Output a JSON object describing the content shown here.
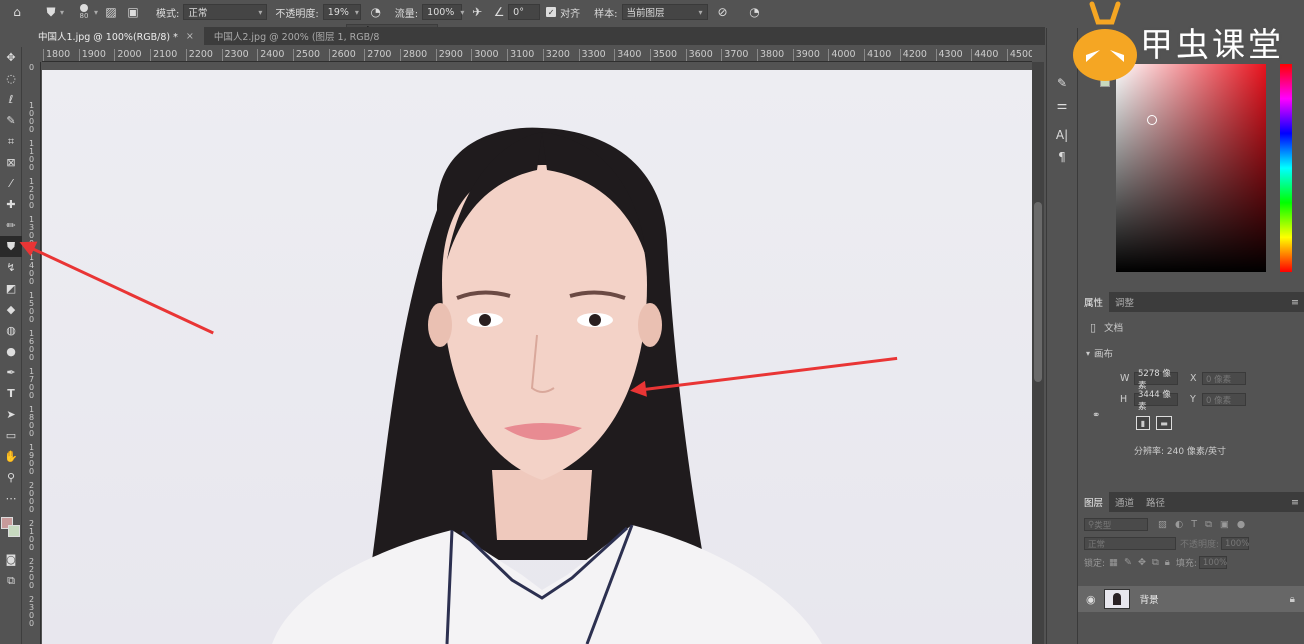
{
  "options_bar": {
    "brush_size": "80",
    "mode_label": "模式:",
    "mode_value": "正常",
    "opacity_label": "不透明度:",
    "opacity_value": "19%",
    "flow_label": "流量:",
    "flow_value": "100%",
    "angle_value": "0°",
    "align_label": "对齐",
    "sample_label": "样本:",
    "sample_value": "当前图层"
  },
  "tabs": [
    {
      "label": "中国人1.jpg @ 100%(RGB/8) *",
      "close": "×"
    },
    {
      "label": "中国人2.jpg @ 200% (图层 1, RGB/8"
    }
  ],
  "ruler_top": [
    "1800",
    "1900",
    "2000",
    "2100",
    "2200",
    "2300",
    "2400",
    "2500",
    "2600",
    "2700",
    "2800",
    "2900",
    "3000",
    "3100",
    "3200",
    "3300",
    "3400",
    "3500",
    "3600",
    "3700",
    "3800",
    "3900",
    "4000",
    "4100",
    "4200",
    "4300",
    "4400",
    "4500"
  ],
  "ruler_left": [
    "0",
    "1000",
    "1100",
    "1200",
    "1300",
    "1400",
    "1500",
    "1600",
    "1700",
    "1800",
    "1900",
    "2000",
    "2100",
    "2200",
    "2300"
  ],
  "watermark": {
    "text": "甲虫课堂"
  },
  "properties_panel": {
    "tab_properties": "属性",
    "tab_adjust": "调整",
    "document_label": "文档",
    "canvas_section": "画布",
    "w_label": "W",
    "w_value": "5278 像素",
    "h_label": "H",
    "h_value": "3444 像素",
    "x_label": "X",
    "x_placeholder": "0 像素",
    "y_label": "Y",
    "y_placeholder": "0 像素",
    "resolution": "分辨率: 240 像素/英寸"
  },
  "layers_panel": {
    "tab_layers": "图层",
    "tab_channels": "通道",
    "tab_paths": "路径",
    "kind_placeholder": "类型",
    "blend_mode": "正常",
    "opacity_label": "不透明度:",
    "opacity_value": "100%",
    "lock_label": "锁定:",
    "fill_label": "填充:",
    "fill_value": "100%",
    "layer_name": "背景"
  },
  "colors": {
    "accent_arrow": "#e93535",
    "foreground": "#c79a9a",
    "background_swatch": "#c7d9bf"
  }
}
